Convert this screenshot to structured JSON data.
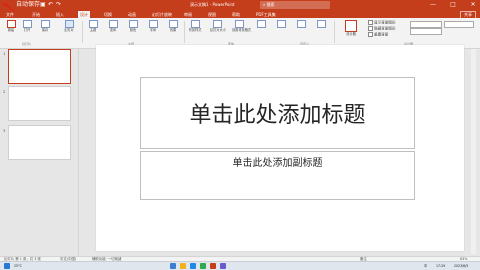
{
  "titlebar": {
    "title": "演示文稿1 - PowerPoint",
    "search_placeholder": "搜索",
    "autosave": "自动保存",
    "qa_save": "▣",
    "qa_undo": "↶",
    "qa_redo": "↷",
    "minimize": "—",
    "maximize": "□",
    "close": "✕"
  },
  "tabs": {
    "items": [
      "文件",
      "开始",
      "插入",
      "设计",
      "切换",
      "动画",
      "幻灯片放映",
      "审阅",
      "视图",
      "帮助",
      "PDF工具集"
    ],
    "active_index": 3,
    "share": "共享"
  },
  "ribbon": {
    "buttons": [
      "新建",
      "打开",
      "保存",
      "幻灯片",
      "主题",
      "变体",
      "颜色",
      "字体",
      "效果",
      "背景样式",
      "幻灯片大小",
      "设置背景格式",
      "设计器"
    ],
    "selected_button_index": 3,
    "groups": [
      "幻灯片",
      "主题",
      "变体",
      "自定义",
      "设计器"
    ],
    "options": [
      "显示背景图形",
      "隐藏背景图形",
      "重置背景"
    ]
  },
  "leftpane": {
    "slide_numbers": [
      "1",
      "2",
      "3"
    ]
  },
  "slide": {
    "title_placeholder": "单击此处添加标题",
    "subtitle_placeholder": "单击此处添加副标题"
  },
  "statusbar": {
    "slide_info": "幻灯片 第 1 张，共 3 张",
    "language": "中文(中国)",
    "accessibility": "辅助功能: 一切就绪",
    "notes": "备注",
    "zoom": "63%"
  },
  "taskbar": {
    "temp": "25°C",
    "time": "17:29",
    "date": "2023/6/5",
    "lang": "中"
  },
  "colors": {
    "accent": "#c43e1c",
    "ribbon_bg": "#f3f3f3",
    "canvas_bg": "#e6e6e6"
  }
}
